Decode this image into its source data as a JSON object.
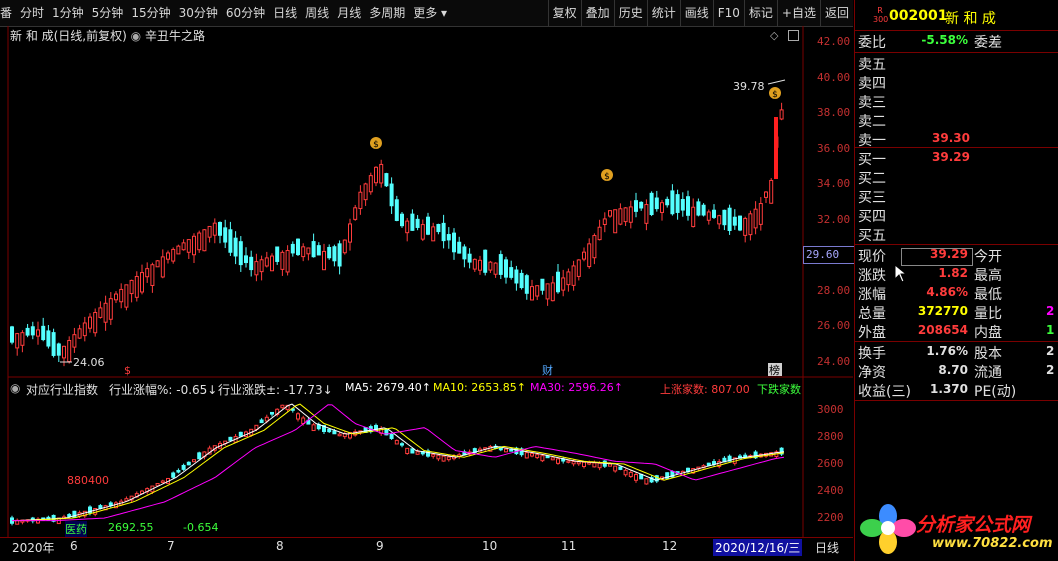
{
  "toolbar": {
    "left_items": [
      "番",
      "分时",
      "1分钟",
      "5分钟",
      "15分钟",
      "30分钟",
      "60分钟",
      "日线",
      "周线",
      "月线",
      "多周期",
      "更多 ▾"
    ],
    "right_items": [
      "复权",
      "叠加",
      "历史",
      "统计",
      "画线",
      "F10",
      "标记",
      "+自选",
      "返回"
    ]
  },
  "main": {
    "title": "新 和 成(日线,前复权)",
    "indicator": "辛丑牛之路",
    "price_labels": {
      "high": "39.78",
      "low": "24.06"
    },
    "markers": {
      "cai": "财",
      "bang": "榜",
      "s": "$"
    },
    "current_price_tag": "29.60",
    "y_ticks": [
      "42.00",
      "40.00",
      "38.00",
      "36.00",
      "34.00",
      "32.00",
      "30.00",
      "28.00",
      "26.00",
      "24.00"
    ]
  },
  "sub": {
    "title": "对应行业指数",
    "ind_zhangfu": "行业涨幅%: -0.65↓",
    "ind_zhangdie": "行业涨跌±: -17.73↓",
    "ma5": "MA5: 2679.40↑",
    "ma10": "MA10: 2653.85↑",
    "ma30": "MA30: 2596.26↑",
    "up_count": "上涨家数: 807.00",
    "down_count": "下跌家数",
    "code": "880400",
    "name": "医药",
    "value": "2692.55",
    "change": "-0.654",
    "y_ticks": [
      "3000",
      "2800",
      "2600",
      "2400",
      "2200"
    ]
  },
  "xaxis": {
    "labels": [
      "2020年",
      "6",
      "7",
      "8",
      "9",
      "10",
      "11",
      "12"
    ],
    "date_box": "2020/12/16/三",
    "period": "日线"
  },
  "panel": {
    "badge_top": "R",
    "badge_bottom": "300",
    "code": "002001",
    "name": "新 和 成",
    "weibi_label": "委比",
    "weibi_value": "-5.58%",
    "weicha_label": "委差",
    "sell": [
      {
        "label": "卖五",
        "price": ""
      },
      {
        "label": "卖四",
        "price": ""
      },
      {
        "label": "卖三",
        "price": ""
      },
      {
        "label": "卖二",
        "price": ""
      },
      {
        "label": "卖一",
        "price": "39.30"
      }
    ],
    "buy": [
      {
        "label": "买一",
        "price": "39.29"
      },
      {
        "label": "买二",
        "price": ""
      },
      {
        "label": "买三",
        "price": ""
      },
      {
        "label": "买四",
        "price": ""
      },
      {
        "label": "买五",
        "price": ""
      }
    ],
    "quote": [
      {
        "l1": "现价",
        "v1": "39.29",
        "l2": "今开",
        "v2": ""
      },
      {
        "l1": "涨跌",
        "v1": "1.82",
        "l2": "最高",
        "v2": ""
      },
      {
        "l1": "涨幅",
        "v1": "4.86%",
        "l2": "最低",
        "v2": ""
      },
      {
        "l1": "总量",
        "v1": "372770",
        "l2": "量比",
        "v2": "2"
      },
      {
        "l1": "外盘",
        "v1": "208654",
        "l2": "内盘",
        "v2": "1"
      }
    ],
    "finance": [
      {
        "l1": "换手",
        "v1": "1.76%",
        "l2": "股本",
        "v2": "2"
      },
      {
        "l1": "净资",
        "v1": "8.70",
        "l2": "流通",
        "v2": "2"
      },
      {
        "l1": "收益(三)",
        "v1": "1.370",
        "l2": "PE(动)",
        "v2": ""
      }
    ],
    "logo_text": "分析家公式网",
    "logo_url": "www.70822.com"
  },
  "colors": {
    "up": "#ff3c3c",
    "down": "#54ffff",
    "ma5": "#ffffff",
    "ma10": "#ffff00",
    "ma30": "#ff00ff"
  }
}
